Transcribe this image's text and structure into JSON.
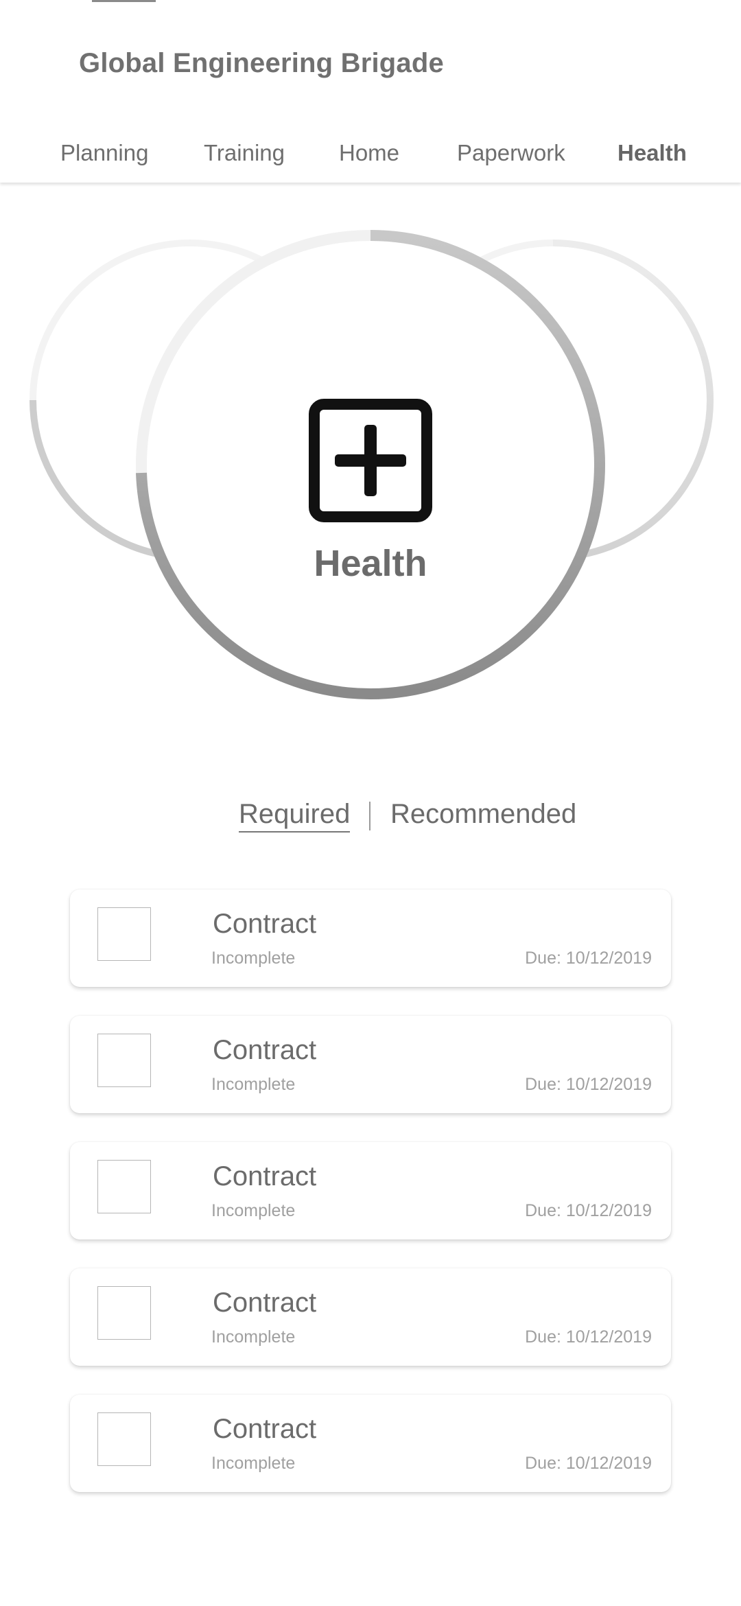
{
  "app": {
    "title": "Global Engineering Brigade"
  },
  "nav": {
    "items": [
      {
        "label": "Planning",
        "active": false
      },
      {
        "label": "Training",
        "active": false
      },
      {
        "label": "Home",
        "active": false
      },
      {
        "label": "Paperwork",
        "active": false
      },
      {
        "label": "Health",
        "active": true
      }
    ]
  },
  "hero": {
    "label": "Health",
    "icon": "medical-plus-icon"
  },
  "segment": {
    "required_label": "Required",
    "recommended_label": "Recommended",
    "selected": "Required"
  },
  "tasks": [
    {
      "title": "Contract",
      "status": "Incomplete",
      "due": "Due: 10/12/2019",
      "checked": false
    },
    {
      "title": "Contract",
      "status": "Incomplete",
      "due": "Due: 10/12/2019",
      "checked": false
    },
    {
      "title": "Contract",
      "status": "Incomplete",
      "due": "Due: 10/12/2019",
      "checked": false
    },
    {
      "title": "Contract",
      "status": "Incomplete",
      "due": "Due: 10/12/2019",
      "checked": false
    },
    {
      "title": "Contract",
      "status": "Incomplete",
      "due": "Due: 10/12/2019",
      "checked": false
    }
  ],
  "colors": {
    "text": "#6b6b6b",
    "muted": "#a0a0a0",
    "ring_track": "#f2f2f2",
    "ring_progress_dark": "#8c8c8c",
    "ring_progress_light": "#cfcfcf"
  }
}
